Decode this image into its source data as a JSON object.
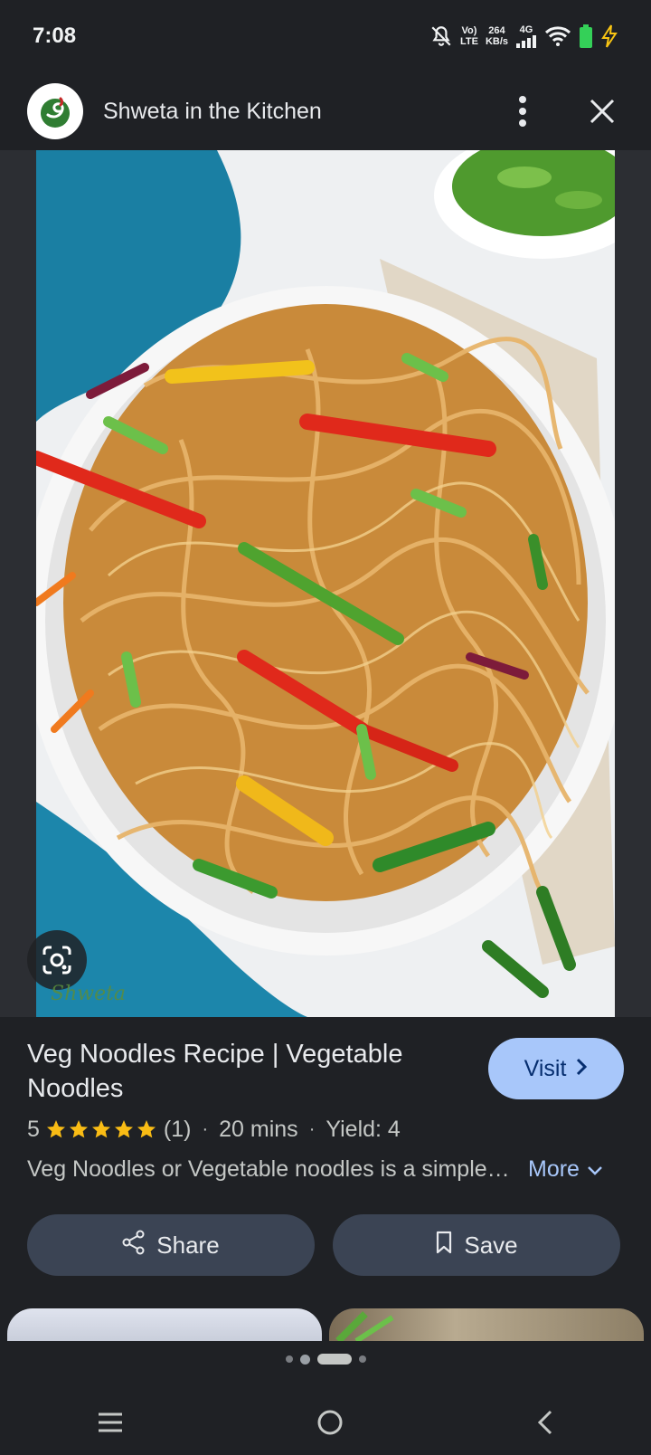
{
  "status_bar": {
    "time": "7:08",
    "volte": "Vo)",
    "lte": "LTE",
    "speed_value": "264",
    "speed_unit": "KB/s",
    "network": "4G",
    "icons": [
      "mute-bell-icon",
      "signal-icon",
      "wifi-icon",
      "battery-icon",
      "charging-icon"
    ]
  },
  "source": {
    "name": "Shweta in the Kitchen",
    "logo_icon": "shweta-logo-icon",
    "more_icon": "more-vert-icon",
    "close_icon": "close-icon"
  },
  "image": {
    "alt": "Veg noodles in a white bowl",
    "watermark": "Shweta",
    "lens_icon": "lens-icon"
  },
  "recipe": {
    "title": "Veg Noodles Recipe | Vegetable Noodles",
    "visit_label": "Visit",
    "rating": "5",
    "stars": 5,
    "review_count": "(1)",
    "time": "20 mins",
    "yield": "Yield: 4",
    "separator": "·",
    "description": "Veg Noodles or Vegetable noodles is a simple…",
    "more_label": "More"
  },
  "actions": {
    "share_label": "Share",
    "save_label": "Save"
  },
  "colors": {
    "background": "#1f2125",
    "accent": "#a8c7fa",
    "button": "#3b4454",
    "star": "#f9bc15"
  }
}
